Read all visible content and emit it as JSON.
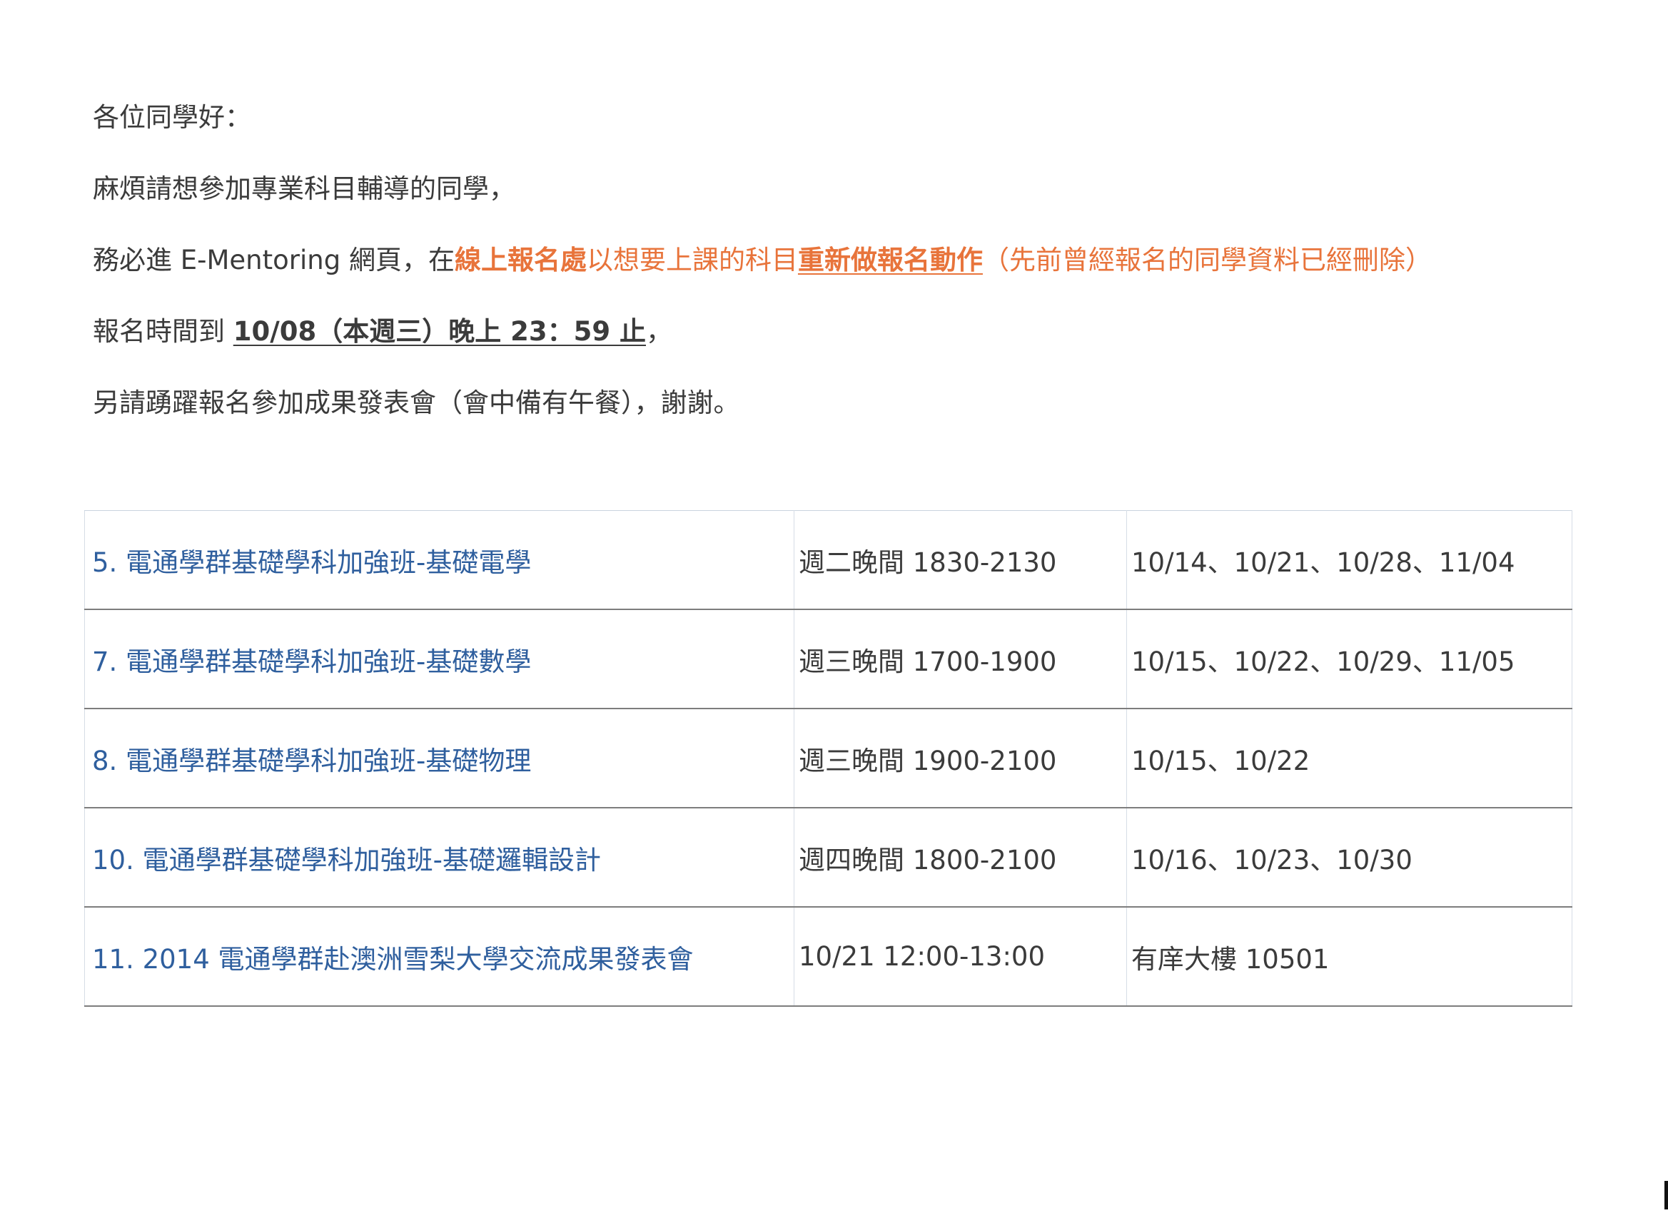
{
  "notice": {
    "greeting": "各位同學好：",
    "line2": "麻煩請想參加專業科目輔導的同學，",
    "line3": {
      "prefix": "務必進 E-Mentoring 網頁，在",
      "highlight1": "線上報名處",
      "mid": "以想要上課的科目",
      "highlight2": "重新做報名動作",
      "suffix": "（先前曾經報名的同學資料已經刪除）"
    },
    "line4": {
      "prefix": "報名時間到",
      "deadline": "10/08（本週三）晚上 23：59 止",
      "suffix": "，"
    },
    "line5": "另請踴躍報名參加成果發表會（會中備有午餐），謝謝。"
  },
  "schedule": {
    "rows": [
      {
        "course": "5.  電通學群基礎學科加強班-基礎電學",
        "time": "週二晚間 1830-2130",
        "dates": "10/14、10/21、10/28、11/04"
      },
      {
        "course": "7.  電通學群基礎學科加強班-基礎數學",
        "time": "週三晚間 1700-1900",
        "dates": "10/15、10/22、10/29、11/05"
      },
      {
        "course": "8.  電通學群基礎學科加強班-基礎物理",
        "time": "週三晚間 1900-2100",
        "dates": "10/15、10/22"
      },
      {
        "course": "10.  電通學群基礎學科加強班-基礎邏輯設計",
        "time": "週四晚間 1800-2100",
        "dates": "10/16、10/23、10/30"
      },
      {
        "course": "11. 2014 電通學群赴澳洲雪梨大學交流成果發表會",
        "time": "10/21 12:00-13:00",
        "dates": "有庠大樓 10501"
      }
    ]
  }
}
